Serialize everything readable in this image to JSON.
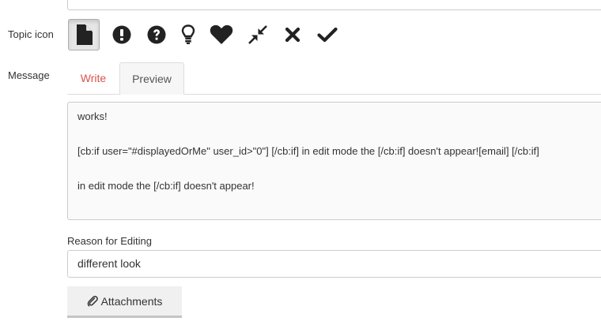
{
  "form": {
    "topic_icon_label": "Topic icon",
    "message_label": "Message",
    "reason_label": "Reason for Editing",
    "reason_value": "different look",
    "attachments_label": "Attachments"
  },
  "icons": [
    {
      "name": "file-icon",
      "selected": true
    },
    {
      "name": "exclamation-circle-icon",
      "selected": false
    },
    {
      "name": "question-circle-icon",
      "selected": false
    },
    {
      "name": "lightbulb-icon",
      "selected": false
    },
    {
      "name": "heart-icon",
      "selected": false
    },
    {
      "name": "compress-icon",
      "selected": false
    },
    {
      "name": "times-icon",
      "selected": false
    },
    {
      "name": "check-icon",
      "selected": false
    }
  ],
  "tabs": {
    "write": "Write",
    "preview": "Preview",
    "active": "preview"
  },
  "message": {
    "lines": [
      "works!",
      "[cb:if user=\"#displayedOrMe\" user_id>\"0\"] [/cb:if] in edit mode the [/cb:if] doesn't appear![email] [/cb:if]",
      "in edit mode the [/cb:if] doesn't appear!"
    ]
  },
  "colors": {
    "write_tab": "#d9534f",
    "icon": "#222222"
  }
}
